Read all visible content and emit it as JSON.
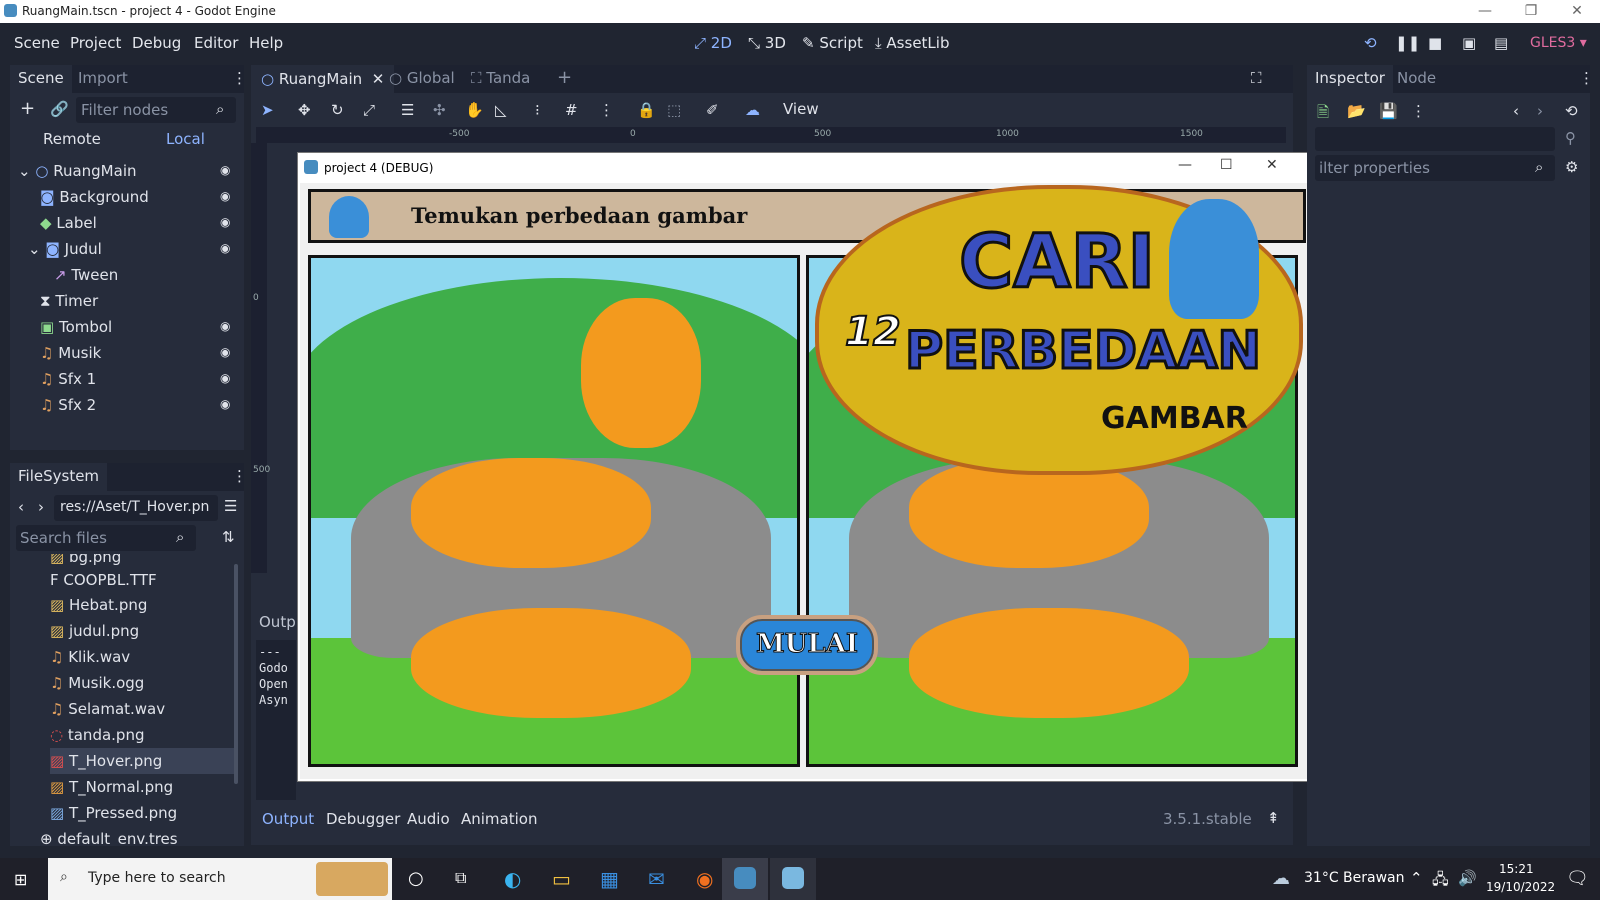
{
  "window": {
    "title": "RuangMain.tscn - project 4 - Godot Engine"
  },
  "menubar": {
    "menus": [
      "Scene",
      "Project",
      "Debug",
      "Editor",
      "Help"
    ],
    "workspaces": {
      "w2d": "2D",
      "w3d": "3D",
      "script": "Script",
      "assetlib": "AssetLib"
    },
    "renderer": "GLES3"
  },
  "scene_dock": {
    "tabs": {
      "scene": "Scene",
      "import": "Import"
    },
    "filter_placeholder": "Filter nodes",
    "remote": "Remote",
    "local": "Local",
    "nodes": [
      {
        "name": "RuangMain"
      },
      {
        "name": "Background"
      },
      {
        "name": "Label"
      },
      {
        "name": "Judul"
      },
      {
        "name": "Tween"
      },
      {
        "name": "Timer"
      },
      {
        "name": "Tombol"
      },
      {
        "name": "Musik"
      },
      {
        "name": "Sfx 1"
      },
      {
        "name": "Sfx 2"
      }
    ]
  },
  "filesystem": {
    "title": "FileSystem",
    "path": "res://Aset/T_Hover.pn",
    "search_placeholder": "Search files",
    "files": [
      "bg.png",
      "COOPBL.TTF",
      "Hebat.png",
      "judul.png",
      "Klik.wav",
      "Musik.ogg",
      "Selamat.wav",
      "tanda.png",
      "T_Hover.png",
      "T_Normal.png",
      "T_Pressed.png",
      "default_env.tres"
    ],
    "selected": "T_Hover.png"
  },
  "editor_tabs": {
    "main": "RuangMain",
    "global": "Global",
    "tanda": "Tanda",
    "view": "View"
  },
  "ruler": {
    "labels": [
      "-500",
      "0",
      "500",
      "1000",
      "1500"
    ],
    "v_labels": [
      "0",
      "500"
    ]
  },
  "game_window": {
    "title": "project 4 (DEBUG)",
    "header_text": "Temukan perbedaan gambar",
    "logo_line1": "CARI",
    "logo_number": "12",
    "logo_line2": "PERBEDAAN",
    "logo_line3": "GAMBAR",
    "button": "MULAI"
  },
  "output_panel": {
    "label": "Outp",
    "lines": [
      "---",
      "Godo",
      "Open",
      "Asyn"
    ],
    "tabs": [
      "Output",
      "Debugger",
      "Audio",
      "Animation"
    ],
    "version": "3.5.1.stable"
  },
  "inspector": {
    "tabs": {
      "inspector": "Inspector",
      "node": "Node"
    },
    "filter_placeholder": "ilter properties"
  },
  "taskbar": {
    "search_placeholder": "Type here to search",
    "weather": "31°C  Berawan",
    "time": "15:21",
    "date": "19/10/2022"
  }
}
